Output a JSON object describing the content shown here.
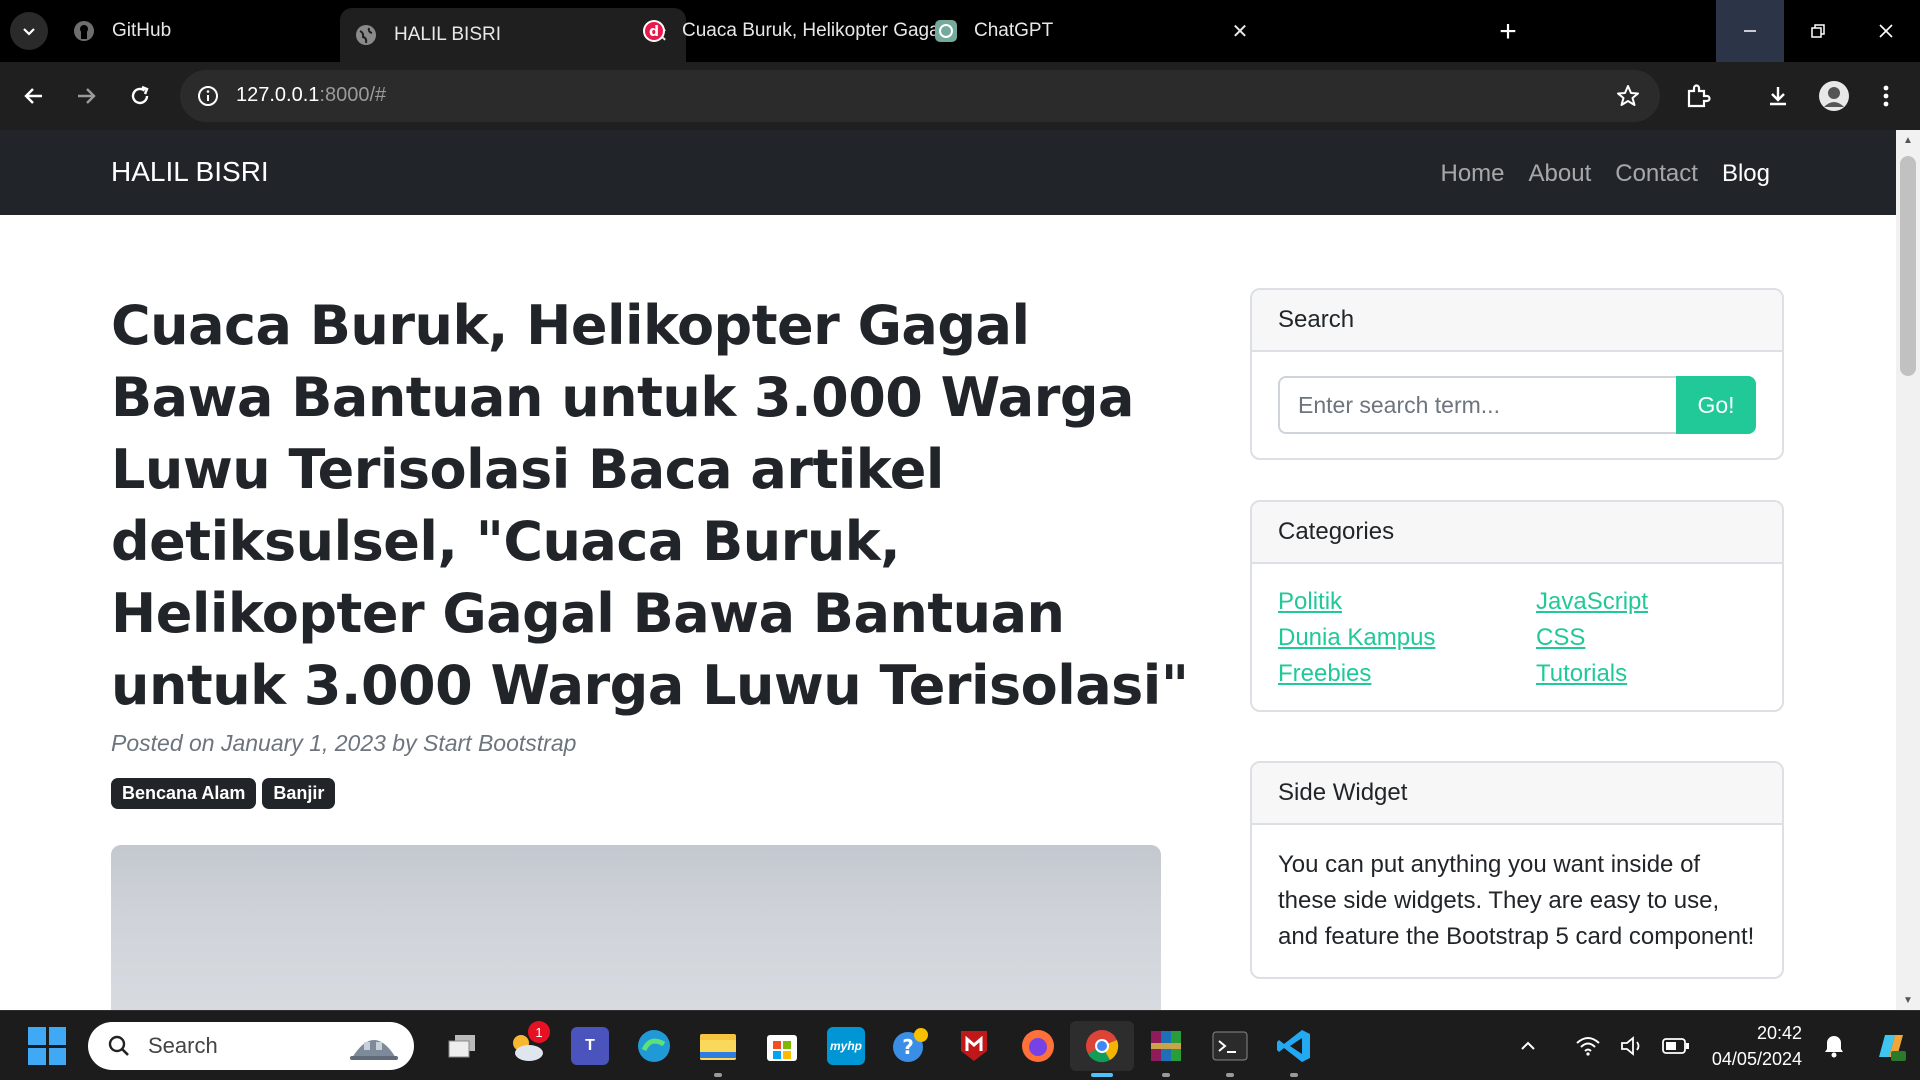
{
  "browser": {
    "tabs": [
      {
        "title": "GitHub",
        "favicon": "github-icon",
        "active": false
      },
      {
        "title": "HALIL BISRI",
        "favicon": "globe-icon",
        "active": true
      },
      {
        "title": "Cuaca Buruk, Helikopter Gagal B",
        "favicon": "detik-icon",
        "active": false
      },
      {
        "title": "ChatGPT",
        "favicon": "chatgpt-icon",
        "active": false
      }
    ],
    "url_host": "127.0.0.1",
    "url_rest": ":8000/#"
  },
  "site": {
    "brand": "HALIL BISRI",
    "nav": [
      "Home",
      "About",
      "Contact",
      "Blog"
    ],
    "active_nav": "Blog"
  },
  "post": {
    "title": "Cuaca Buruk, Helikopter Gagal Bawa Bantuan untuk 3.000 Warga Luwu Terisolasi Baca artikel detiksulsel, \"Cuaca Buruk, Helikopter Gagal Bawa Bantuan untuk 3.000 Warga Luwu Terisolasi\"",
    "meta": "Posted on January 1, 2023 by Start Bootstrap",
    "tags": [
      "Bencana Alam",
      "Banjir"
    ]
  },
  "sidebar": {
    "search": {
      "header": "Search",
      "placeholder": "Enter search term...",
      "button": "Go!"
    },
    "categories": {
      "header": "Categories",
      "items": [
        "Politik",
        "JavaScript",
        "Dunia Kampus",
        "CSS",
        "Freebies",
        "Tutorials"
      ]
    },
    "widget": {
      "header": "Side Widget",
      "text": "You can put anything you want inside of these side widgets. They are easy to use, and feature the Bootstrap 5 card component!"
    }
  },
  "taskbar": {
    "search_label": "Search",
    "teams_badge": "1",
    "time": "20:42",
    "date": "04/05/2024"
  },
  "colors": {
    "accent": "#20c997",
    "navbar": "#212529",
    "badge": "#212529"
  }
}
